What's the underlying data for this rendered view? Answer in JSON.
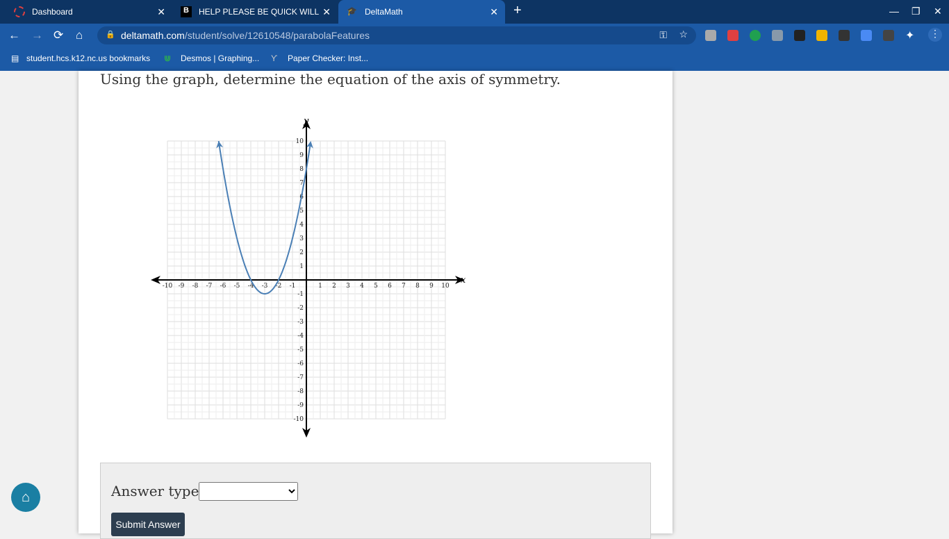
{
  "tabs": [
    {
      "title": "Dashboard"
    },
    {
      "title": "HELP PLEASE BE QUICK WILL GI"
    },
    {
      "title": "DeltaMath"
    }
  ],
  "address": {
    "host": "deltamath.com",
    "path": "/student/solve/12610548/parabolaFeatures"
  },
  "bookmarks": [
    "student.hcs.k12.nc.us bookmarks",
    "Desmos | Graphing...",
    "Paper Checker: Inst..."
  ],
  "question": "Using the graph, determine the equation of the axis of symmetry.",
  "answer": {
    "label": "Answer type:",
    "select_value": "",
    "submit": "Submit Answer"
  },
  "chart_data": {
    "type": "line",
    "title": "",
    "xlabel": "x",
    "ylabel": "y",
    "xlim": [
      -10,
      10
    ],
    "ylim": [
      -10,
      10
    ],
    "grid": true,
    "xticks": [
      -10,
      -9,
      -8,
      -7,
      -6,
      -5,
      -4,
      -3,
      -2,
      -1,
      1,
      2,
      3,
      4,
      5,
      6,
      7,
      8,
      9,
      10
    ],
    "yticks": [
      -10,
      -9,
      -8,
      -7,
      -6,
      -5,
      -4,
      -3,
      -2,
      -1,
      1,
      2,
      3,
      4,
      5,
      6,
      7,
      8,
      9,
      10
    ],
    "series": [
      {
        "name": "parabola",
        "equation": "y=(x+3)^2-1",
        "vertex": [
          -3,
          -1
        ],
        "x_intercepts": [
          -4,
          -2
        ],
        "y_intercept": 8,
        "color": "#4a7fb5"
      }
    ]
  }
}
